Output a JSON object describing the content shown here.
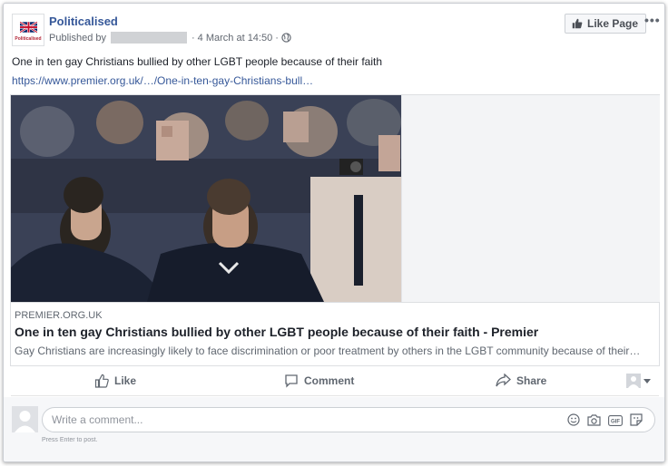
{
  "post": {
    "page_name": "Politicalised",
    "published_by_label": "Published by",
    "timestamp": "4 March at 14:50",
    "like_page_label": "Like Page",
    "more_icon": "more-horizontal-icon",
    "logo_text": "Politicalised",
    "text": "One in ten gay Christians bullied by other LGBT people because of their faith",
    "link_text": "https://www.premier.org.uk/…/One-in-ten-gay-Christians-bull…"
  },
  "link_preview": {
    "domain": "PREMIER.ORG.UK",
    "headline": "One in ten gay Christians bullied by other LGBT people because of their faith - Premier",
    "description": "Gay Christians are increasingly likely to face discrimination or poor treatment by others in the LGBT community because of their…"
  },
  "actions": {
    "like_label": "Like",
    "comment_label": "Comment",
    "share_label": "Share"
  },
  "comment_box": {
    "placeholder": "Write a comment...",
    "hint": "Press Enter to post."
  },
  "colors": {
    "link": "#365899",
    "secondary_text": "#616770",
    "comment_bg": "#f6f7f9"
  }
}
